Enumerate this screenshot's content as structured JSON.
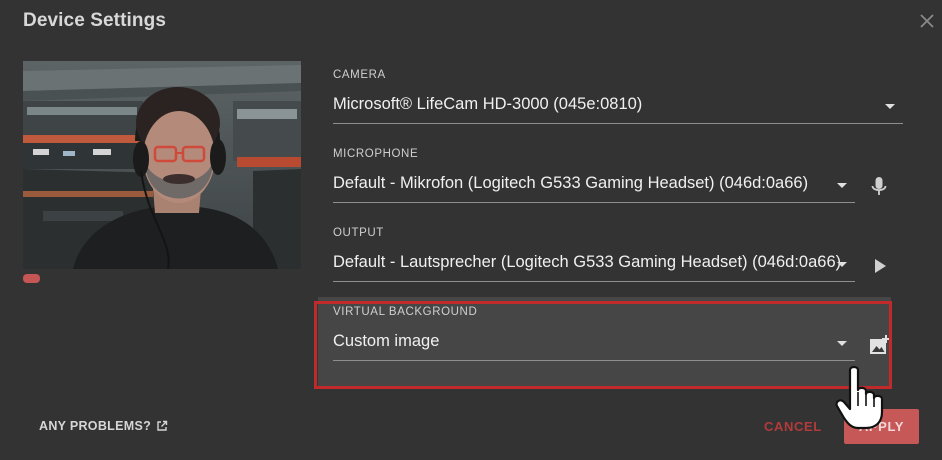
{
  "dialog": {
    "title": "Device Settings"
  },
  "camera": {
    "label": "CAMERA",
    "selected": "Microsoft® LifeCam HD-3000 (045e:0810)"
  },
  "microphone": {
    "label": "MICROPHONE",
    "selected": "Default - Mikrofon (Logitech G533 Gaming Headset) (046d:0a66)"
  },
  "output": {
    "label": "OUTPUT",
    "selected": "Default - Lautsprecher (Logitech G533 Gaming Headset) (046d:0a66)"
  },
  "virtual_background": {
    "label": "VIRTUAL BACKGROUND",
    "selected": "Custom image"
  },
  "footer": {
    "problems_label": "ANY PROBLEMS?",
    "cancel_label": "CANCEL",
    "apply_label": "APPLY"
  },
  "icons": {
    "close": "close-icon",
    "microphone": "microphone-icon",
    "play": "play-icon",
    "add_image": "add-image-icon",
    "external_link": "external-link-icon",
    "cursor": "hand-pointer-icon"
  },
  "colors": {
    "background": "#333333",
    "accent_red": "#c12a2a",
    "cancel_text": "#b33a3a",
    "apply_button": "#c65858",
    "mic_level": "#c65555"
  }
}
